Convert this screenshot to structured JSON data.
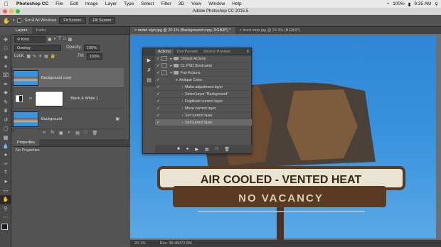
{
  "menubar": {
    "apple_icon": "apple-logo-icon",
    "items": [
      "Photoshop CC",
      "File",
      "Edit",
      "Image",
      "Layer",
      "Type",
      "Select",
      "Filter",
      "3D",
      "View",
      "Window",
      "Help"
    ],
    "battery": "100%",
    "clock": "9:35 AM"
  },
  "window": {
    "title": "Adobe Photoshop CC 2015.5"
  },
  "options_bar": {
    "tool_icon": "hand-tool-icon",
    "scroll_all_label": "Scroll All Windows",
    "fit_screen_1": "Fit Screen",
    "fit_screen_2": "Fill Screen"
  },
  "layers_panel": {
    "tabs": [
      "Layers",
      "Paths"
    ],
    "kind_label": "Kind",
    "blend_mode": "Overlay",
    "opacity_label": "Opacity:",
    "opacity_value": "100%",
    "lock_label": "Lock:",
    "fill_label": "Fill:",
    "fill_value": "100%",
    "layers": [
      {
        "name": "Background copy"
      },
      {
        "name": "Black & White 1"
      },
      {
        "name": "Background"
      }
    ]
  },
  "properties_panel": {
    "title": "Properties",
    "body": "No Properties"
  },
  "doc_tabs": [
    {
      "label": "motel sign.jpg @ 20.1% (Background copy, RGB/8*) *"
    },
    {
      "label": "truck stop.jpg @ 29.3% (RGB/8*)"
    }
  ],
  "status_bar": {
    "zoom": "20.1%",
    "doc_size": "Doc: 39.4M/72.8M"
  },
  "actions_panel": {
    "tabs": [
      "Actions",
      "Tool Presets",
      "Device Preview"
    ],
    "rows": [
      {
        "label": "Default Actions",
        "indent": 0,
        "type": "set"
      },
      {
        "label": "CL PSD Bootcamp",
        "indent": 0,
        "type": "set"
      },
      {
        "label": "Fun Actions",
        "indent": 0,
        "type": "set"
      },
      {
        "label": "Antique Color",
        "indent": 1,
        "type": "action"
      },
      {
        "label": "Make adjustment layer",
        "indent": 2,
        "type": "step"
      },
      {
        "label": "Select layer \"Background\"",
        "indent": 2,
        "type": "step"
      },
      {
        "label": "Duplicate current layer",
        "indent": 2,
        "type": "step"
      },
      {
        "label": "Move current layer",
        "indent": 2,
        "type": "step"
      },
      {
        "label": "Set current layer",
        "indent": 2,
        "type": "step"
      },
      {
        "label": "Set current layer",
        "indent": 2,
        "type": "step"
      }
    ],
    "footer_icons": [
      "stop-icon",
      "record-icon",
      "play-icon",
      "new-set-icon",
      "new-action-icon",
      "trash-icon"
    ]
  },
  "canvas": {
    "sign_text_line1": "AIR COOLED - VENTED HEAT",
    "sign_text_line2": "NO VACANCY"
  },
  "colors": {
    "ui_dark": "#535353",
    "sky": "#3a93dd"
  }
}
